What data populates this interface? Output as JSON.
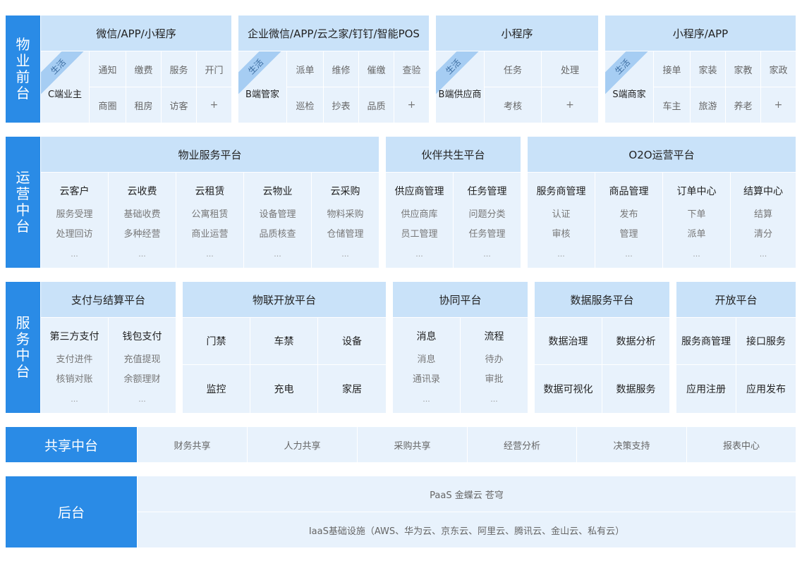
{
  "sections": {
    "front": "物业前台",
    "ops": "运营中台",
    "service": "服务中台",
    "shared": "共享中台",
    "backend": "后台"
  },
  "front": {
    "groups": [
      {
        "header": "微信/APP/小程序",
        "tag": "生活",
        "role": "C端业主",
        "items": [
          "通知",
          "缴费",
          "服务",
          "开门",
          "商圈",
          "租房",
          "访客",
          "+"
        ]
      },
      {
        "header": "企业微信/APP/云之家/钉钉/智能POS",
        "tag": "生活",
        "role": "B端管家",
        "items": [
          "派单",
          "维修",
          "催缴",
          "查验",
          "巡检",
          "抄表",
          "品质",
          "+"
        ]
      },
      {
        "header": "小程序",
        "tag": "生活",
        "role": "B端供应商",
        "items": [
          "任务",
          "处理",
          "考核",
          "+"
        ]
      },
      {
        "header": "小程序/APP",
        "tag": "生活",
        "role": "S端商家",
        "items": [
          "接单",
          "家装",
          "家教",
          "家政",
          "车主",
          "旅游",
          "养老",
          "+"
        ]
      }
    ]
  },
  "ops": {
    "platforms": [
      {
        "header": "物业服务平台",
        "cols": [
          {
            "title": "云客户",
            "items": [
              "服务受理",
              "处理回访",
              "..."
            ]
          },
          {
            "title": "云收费",
            "items": [
              "基础收费",
              "多种经营",
              "..."
            ]
          },
          {
            "title": "云租赁",
            "items": [
              "公寓租赁",
              "商业运营",
              "..."
            ]
          },
          {
            "title": "云物业",
            "items": [
              "设备管理",
              "品质核查",
              "..."
            ]
          },
          {
            "title": "云采购",
            "items": [
              "物料采购",
              "仓储管理",
              "..."
            ]
          }
        ]
      },
      {
        "header": "伙伴共生平台",
        "cols": [
          {
            "title": "供应商管理",
            "items": [
              "供应商库",
              "员工管理",
              "..."
            ]
          },
          {
            "title": "任务管理",
            "items": [
              "问题分类",
              "任务管理",
              "..."
            ]
          }
        ]
      },
      {
        "header": "O2O运营平台",
        "cols": [
          {
            "title": "服务商管理",
            "items": [
              "认证",
              "审核",
              "..."
            ]
          },
          {
            "title": "商品管理",
            "items": [
              "发布",
              "管理",
              "..."
            ]
          },
          {
            "title": "订单中心",
            "items": [
              "下单",
              "派单",
              "..."
            ]
          },
          {
            "title": "结算中心",
            "items": [
              "结算",
              "清分",
              "..."
            ]
          }
        ]
      }
    ]
  },
  "service": {
    "pay": {
      "header": "支付与结算平台",
      "cols": [
        {
          "title": "第三方支付",
          "items": [
            "支付进件",
            "核销对账",
            "..."
          ]
        },
        {
          "title": "钱包支付",
          "items": [
            "充值提现",
            "余额理财",
            "..."
          ]
        }
      ]
    },
    "iot": {
      "header": "物联开放平台",
      "items": [
        "门禁",
        "车禁",
        "设备",
        "监控",
        "充电",
        "家居"
      ]
    },
    "collab": {
      "header": "协同平台",
      "cols": [
        {
          "title": "消息",
          "items": [
            "消息",
            "通讯录",
            "..."
          ]
        },
        {
          "title": "流程",
          "items": [
            "待办",
            "审批",
            "..."
          ]
        }
      ]
    },
    "dataplat": {
      "header": "数据服务平台",
      "items": [
        "数据治理",
        "数据分析",
        "数据可视化",
        "数据服务"
      ]
    },
    "open": {
      "header": "开放平台",
      "items": [
        "服务商管理",
        "接口服务",
        "应用注册",
        "应用发布"
      ]
    }
  },
  "shared": {
    "items": [
      "财务共享",
      "人力共享",
      "采购共享",
      "经营分析",
      "决策支持",
      "报表中心"
    ]
  },
  "backend": {
    "paas": "PaaS 金蝶云 苍穹",
    "iaas": "IaaS基础设施（AWS、华为云、京东云、阿里云、腾讯云、金山云、私有云）"
  }
}
